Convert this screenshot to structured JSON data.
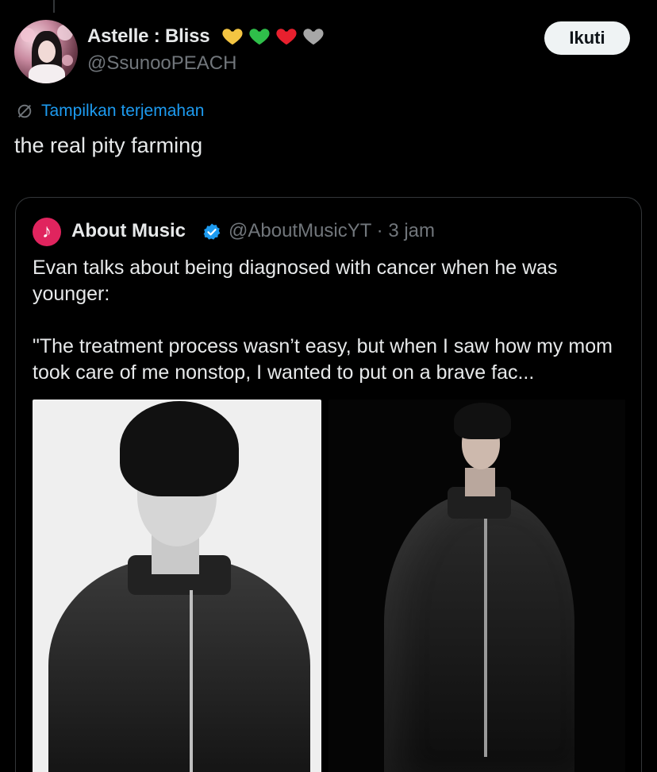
{
  "tweet": {
    "author": {
      "display_name": "Astelle : Bliss",
      "name_emojis": [
        "yellow-heart",
        "green-heart",
        "red-heart",
        "grey-heart"
      ],
      "handle": "@SsunooPEACH"
    },
    "follow_label": "Ikuti",
    "translate_label": "Tampilkan terjemahan",
    "text": "the real pity farming"
  },
  "quote": {
    "author": {
      "avatar_letter": "♪",
      "display_name": "About Music",
      "handle_time": "@AboutMusicYT · 3 jam"
    },
    "paragraphs": [
      "Evan talks about being diagnosed with cancer when he was younger:",
      "\"The treatment process wasn’t easy, but when I saw how my mom took care of me nonstop, I wanted to put on a brave fac..."
    ],
    "images": [
      "photo-black-and-white-portrait",
      "photo-leather-jacket-portrait"
    ]
  },
  "colors": {
    "background": "#000000",
    "text_primary": "#e7e9ea",
    "text_secondary": "#71767b",
    "link": "#1d9bf0",
    "verified": "#1d9bf0",
    "follow_bg": "#eff3f4"
  }
}
